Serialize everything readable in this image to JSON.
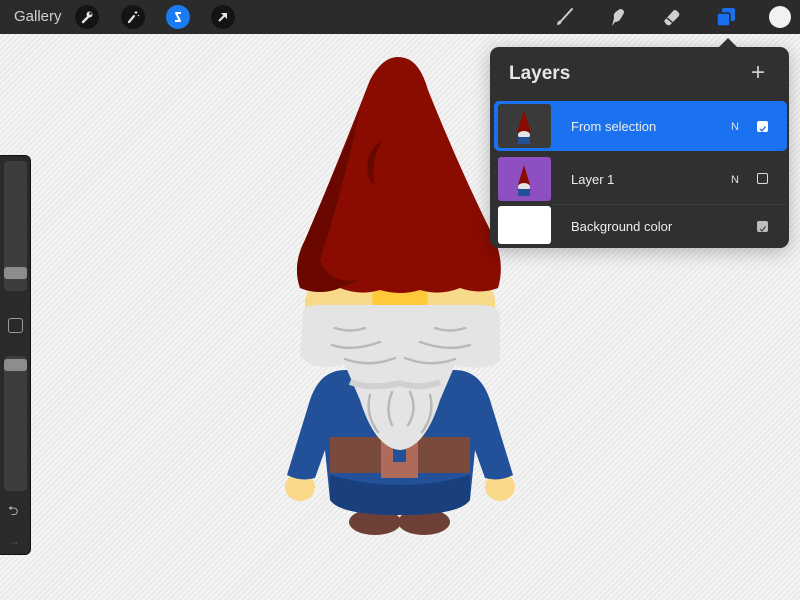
{
  "topbar": {
    "gallery_label": "Gallery",
    "left_icons": [
      "wrench-icon",
      "magic-wand-icon",
      "selection-icon",
      "transform-arrow-icon"
    ],
    "active_left_icon": "selection-icon",
    "tools": [
      "brush-icon",
      "smudge-icon",
      "eraser-icon",
      "layers-icon"
    ],
    "active_tool": "layers-icon",
    "color": "#f1f1f1"
  },
  "sidebar": {
    "brush_size_fraction": 0.15,
    "opacity_fraction": 0.95,
    "modify_button": "square",
    "undo_icon": "undo-icon",
    "redo_icon": "redo-icon"
  },
  "layers_panel": {
    "title": "Layers",
    "add_icon": "plus-icon",
    "layers": [
      {
        "name": "From selection",
        "blend_mode": "N",
        "visible": true,
        "selected": true,
        "thumb_bg": "#3a3a3a"
      },
      {
        "name": "Layer 1",
        "blend_mode": "N",
        "visible": false,
        "selected": false,
        "thumb_bg": "#8e4fc0"
      },
      {
        "name": "Background color",
        "blend_mode": "",
        "visible": true,
        "selected": false,
        "thumb_bg": "#ffffff"
      }
    ]
  },
  "canvas": {
    "subject": "gnome illustration",
    "colors": {
      "hat": "#8a0c00",
      "hat_shadow": "#6a0800",
      "face": "#f7d98a",
      "nose": "#ffc93a",
      "beard": "#e4e4e4",
      "beard_lines": "#b9b9b9",
      "coat": "#22519a",
      "coat_dark": "#1a3f7d",
      "belt": "#7a4b3c",
      "buckle": "#b06a5a",
      "boots": "#6e3f36",
      "hands": "#fbd98b"
    }
  }
}
